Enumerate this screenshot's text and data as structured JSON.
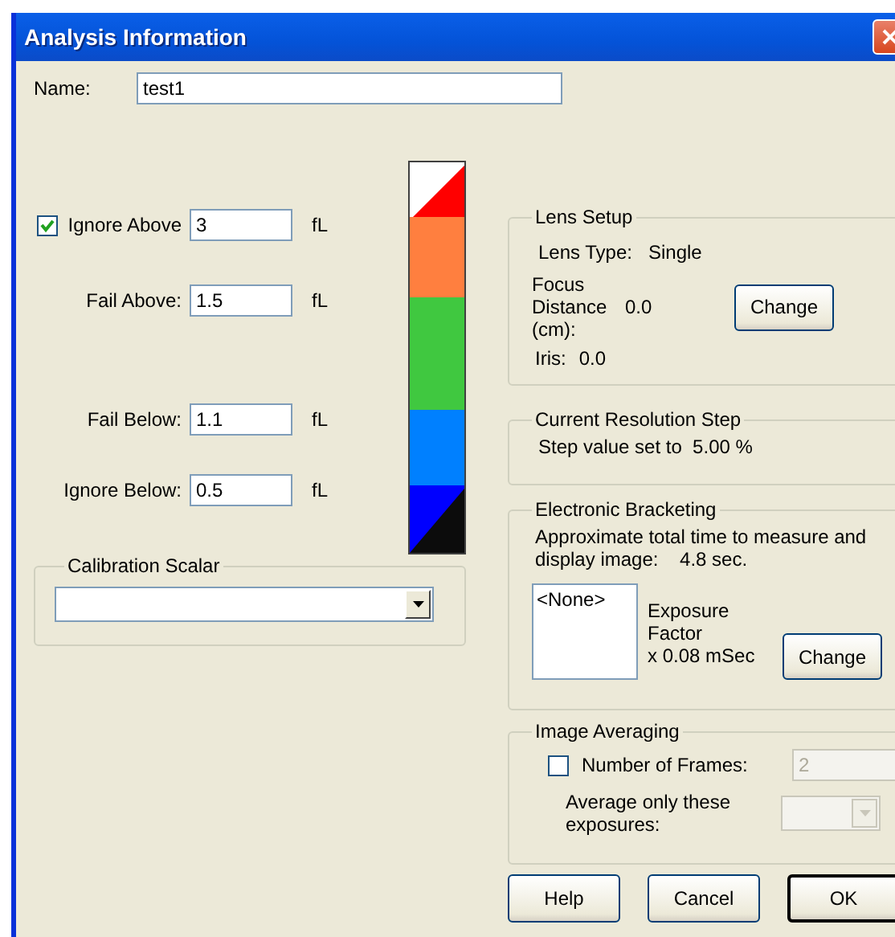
{
  "window": {
    "title": "Analysis Information"
  },
  "name_field": {
    "label": "Name:",
    "value": "test1"
  },
  "thresholds": [
    {
      "kind": "checkbox",
      "label": "Ignore Above",
      "checked": true,
      "value": "3",
      "unit": "fL"
    },
    {
      "kind": "label",
      "label": "Fail Above:",
      "value": "1.5",
      "unit": "fL"
    },
    {
      "kind": "label",
      "label": "Fail Below:",
      "value": "1.1",
      "unit": "fL"
    },
    {
      "kind": "label",
      "label": "Ignore Below:",
      "value": "0.5",
      "unit": "fL"
    }
  ],
  "calibration_scalar": {
    "title": "Calibration Scalar"
  },
  "lens_setup": {
    "title": "Lens Setup",
    "lens_type_label": "Lens Type:",
    "lens_type": "Single",
    "focus_label": "Focus Distance (cm):",
    "focus_value": "0.0",
    "iris_label": "Iris:",
    "iris_value": "0.0",
    "button": "Change"
  },
  "resolution": {
    "title": "Current Resolution Step",
    "text": "Step value set to  5.00 %"
  },
  "bracketing": {
    "title": "Electronic Bracketing",
    "time_text": "Approximate total time to measure and display image:    4.8 sec.",
    "list_items": [
      "<None>"
    ],
    "factor_text": "Exposure\nFactor\nx 0.08 mSec",
    "button": "Change"
  },
  "averaging": {
    "title": "Image Averaging",
    "frames_label": "Number of Frames:",
    "frames_checked": false,
    "frames_value": "2",
    "frames_disabled": true,
    "exposures_label": "Average only these exposures:",
    "exposures_disabled": true
  },
  "buttons": [
    {
      "label": "Help",
      "default": false
    },
    {
      "label": "Cancel",
      "default": false
    },
    {
      "label": "OK",
      "default": true
    }
  ]
}
